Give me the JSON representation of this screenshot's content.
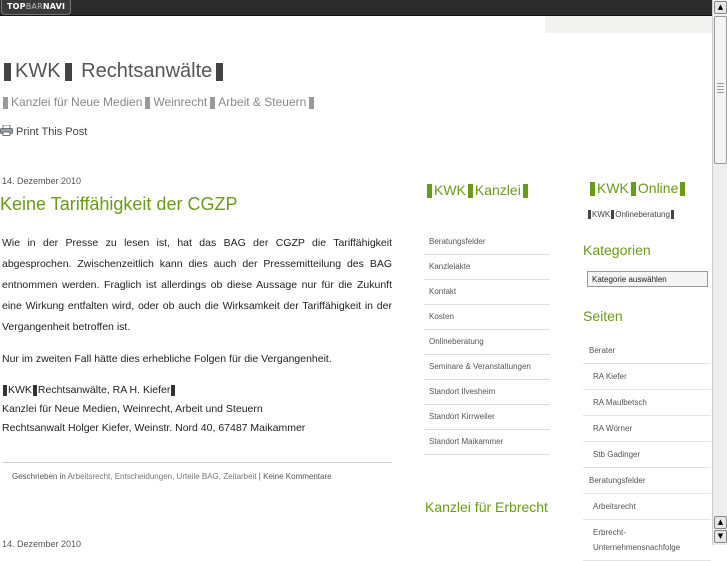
{
  "topbar": {
    "label_a": "TOP",
    "label_b": "BAR",
    "label_c": "NAVI"
  },
  "header": {
    "title_a": "KWK",
    "title_b": "Rechtsanwälte",
    "tagline_a": "Kanzlei für Neue Medien",
    "tagline_b": "Weinrecht",
    "tagline_c": "Arbeit & Steuern"
  },
  "print": {
    "label": "Print This Post"
  },
  "post": {
    "date": "14. Dezember 2010",
    "title": "Keine Tariffähigkeit der CGZP",
    "paragraph1": "Wie in der Presse zu lesen ist, hat das BAG der CGZP die Tariffähigkeit abgesprochen. Zwischenzeitlich kann dies auch der Pressemitteilung des BAG entnommen werden. Fraglich ist allerdings ob diese Aussage nur für die Zukunft eine Wirkung entfalten wird, oder ob auch die Wirksamkeit der Tariffähigkeit in der Vergangenheit betroffen ist.",
    "paragraph2": "Nur im zweiten Fall hätte dies erhebliche Folgen für die Vergangenheit.",
    "sig_a": "KWK",
    "sig_b": "Rechtsanwälte, RA H. Kiefer",
    "sig_line2": "Kanzlei für Neue Medien, Weinrecht, Arbeit und Steuern",
    "sig_line3": "Rechtsanwalt Holger Kiefer, Weinstr. Nord 40, 67487 Maikammer",
    "meta_prefix": "Geschrieben in",
    "meta_cats": "Arbeitsrecht, Entscheidungen, Urteile BAG, Zeitarbeit",
    "meta_sep": " | ",
    "meta_comments": "Keine Kommentare",
    "next_date": "14. Dezember 2010"
  },
  "mid_sidebar": {
    "head_a": "KWK",
    "head_b": "Kanzlei",
    "items": [
      "Beratungsfelder",
      "Kanzleiakte",
      "Kontakt",
      "Kosten",
      "Onlineberatung",
      "Seminare & Veranstaltungen",
      "Standort Ilvesheim",
      "Standort Kirrweiler",
      "Standort Maikammer"
    ],
    "head2": "Kanzlei für Erbrecht"
  },
  "right_sidebar": {
    "head_a": "KWK",
    "head_b": "Online",
    "sub_a": "KWK",
    "sub_b": "Onlineberatung",
    "categories_head": "Kategorien",
    "categories_select": "Kategorie auswählen",
    "pages_head": "Seiten",
    "pages": [
      {
        "label": "Berater",
        "sub": false
      },
      {
        "label": "RA Kiefer",
        "sub": true
      },
      {
        "label": "RA Maulbetsch",
        "sub": true
      },
      {
        "label": "RA Wörner",
        "sub": true
      },
      {
        "label": "Stb Gadinger",
        "sub": true
      },
      {
        "label": "Beratungsfelder",
        "sub": false
      },
      {
        "label": "Arbeitsrecht",
        "sub": true
      },
      {
        "label": "Erbrecht-Unternehmensnachfolge",
        "sub": true
      }
    ]
  },
  "scrollbar": {
    "up_icon": "chevron-up-icon",
    "down_icon": "chevron-down-icon"
  }
}
